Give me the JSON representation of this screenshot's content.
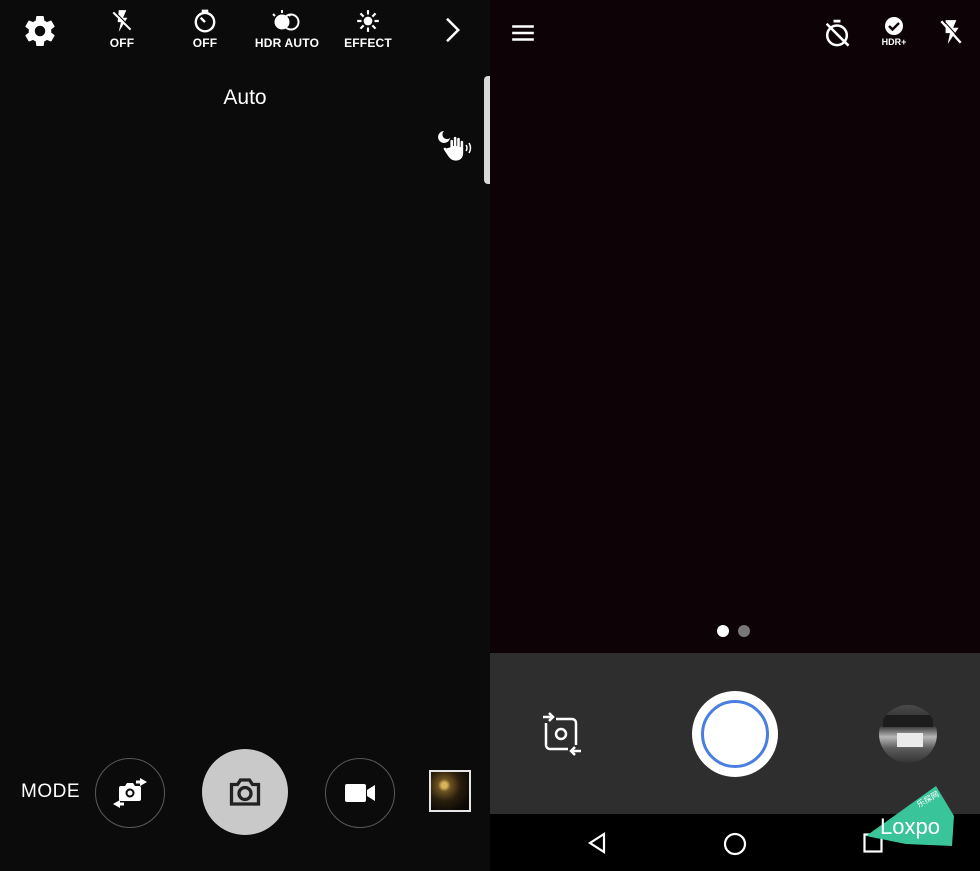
{
  "left_app": {
    "toolbar": {
      "flash": {
        "label": "OFF",
        "icon": "flash-off-icon"
      },
      "timer": {
        "label": "OFF",
        "icon": "timer-icon"
      },
      "hdr": {
        "label": "HDR AUTO",
        "icon": "hdr-icon"
      },
      "effect": {
        "label": "EFFECT",
        "icon": "effect-icon"
      },
      "settings_icon": "gear-icon",
      "more_icon": "chevron-right-icon"
    },
    "shooting_mode": "Auto",
    "gesture_icon": "palm-gesture-icon",
    "bottom": {
      "mode_label": "MODE",
      "switch_camera_icon": "switch-camera-icon",
      "shutter_icon": "camera-icon",
      "video_icon": "video-camera-icon"
    }
  },
  "right_app": {
    "toolbar": {
      "menu_icon": "hamburger-menu-icon",
      "timer_icon": "timer-off-icon",
      "hdr_label": "HDR+",
      "flash_icon": "flash-off-icon"
    },
    "page_indicator": {
      "count": 2,
      "active": 0
    },
    "controls": {
      "rotate_icon": "rotate-camera-icon",
      "shutter_ring_color": "#4a7fe0"
    },
    "navbar": {
      "back_icon": "back-triangle-icon",
      "home_icon": "home-circle-icon",
      "recent_icon": "recent-apps-icon"
    }
  },
  "watermark": {
    "text": "Loxpo",
    "small_text": "乐探网"
  }
}
